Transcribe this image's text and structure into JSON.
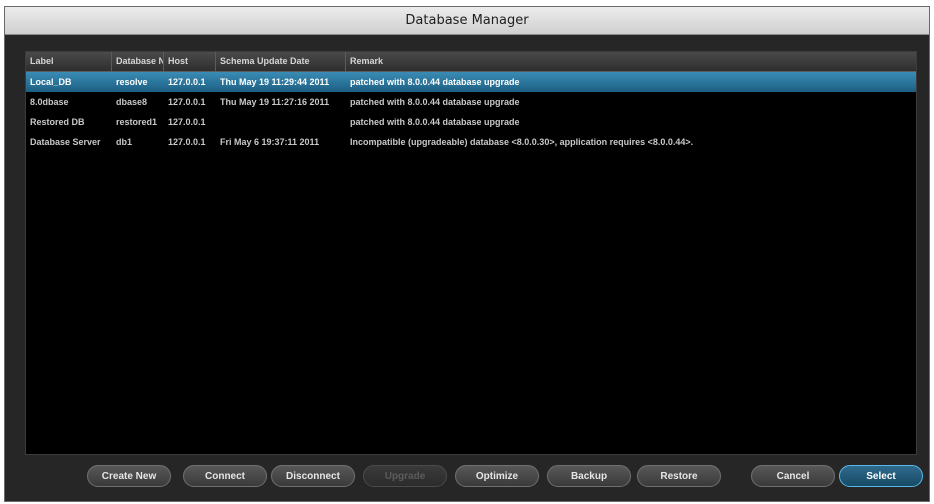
{
  "window": {
    "title": "Database Manager"
  },
  "table": {
    "columns": [
      "Label",
      "Database N",
      "Host",
      "Schema Update Date",
      "Remark"
    ],
    "rows": [
      {
        "label": "Local_DB",
        "database": "resolve",
        "host": "127.0.0.1",
        "date": "Thu May 19 11:29:44 2011",
        "remark": "patched with 8.0.0.44 database upgrade"
      },
      {
        "label": "8.0dbase",
        "database": "dbase8",
        "host": "127.0.0.1",
        "date": "Thu May 19 11:27:16 2011",
        "remark": "patched with 8.0.0.44 database upgrade"
      },
      {
        "label": "Restored DB",
        "database": "restored1",
        "host": "127.0.0.1",
        "date": "",
        "remark": "patched with 8.0.0.44 database upgrade"
      },
      {
        "label": "Database Server",
        "database": "db1",
        "host": "127.0.0.1",
        "date": "Fri May 6 19:37:11 2011",
        "remark": "Incompatible (upgradeable) database <8.0.0.30>, application requires <8.0.0.44>."
      }
    ],
    "selected_row": 0
  },
  "buttons": {
    "create_new": "Create New",
    "connect": "Connect",
    "disconnect": "Disconnect",
    "upgrade": "Upgrade",
    "optimize": "Optimize",
    "backup": "Backup",
    "restore": "Restore",
    "cancel": "Cancel",
    "select": "Select"
  },
  "colors": {
    "selection": "#2a7aa4",
    "primary_border": "#5ab8e8",
    "background": "#000000"
  }
}
